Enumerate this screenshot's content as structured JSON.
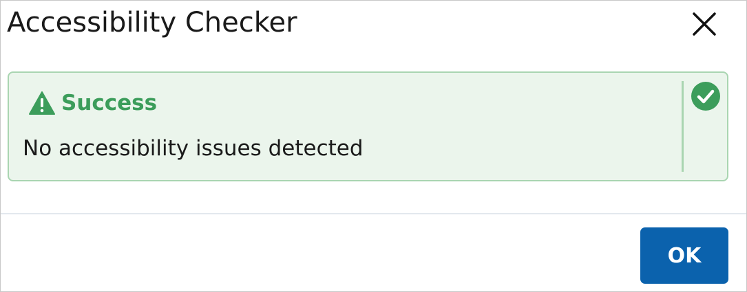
{
  "dialog": {
    "title": "Accessibility Checker",
    "close_icon": "close-icon"
  },
  "alert": {
    "status": "success",
    "icon": "warning-triangle-icon",
    "title": "Success",
    "message": "No accessibility issues detected",
    "status_icon": "check-circle-icon"
  },
  "footer": {
    "ok_label": "OK"
  },
  "colors": {
    "success_text": "#3c9d5b",
    "success_bg": "#ebf5ec",
    "success_border": "#a9d5b1",
    "primary_button": "#0b62ad"
  }
}
